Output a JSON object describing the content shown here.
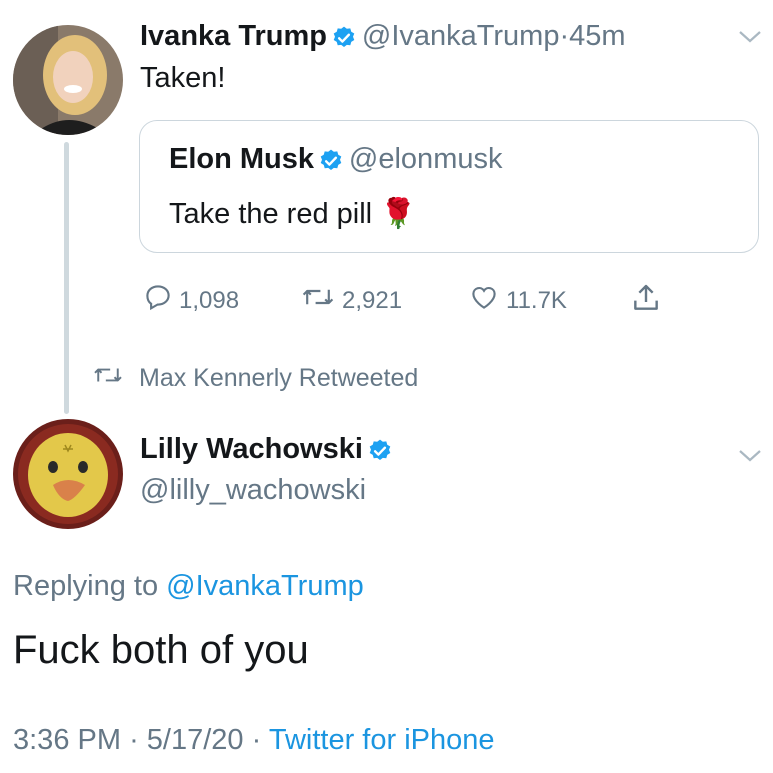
{
  "tweet1": {
    "name": "Ivanka Trump",
    "handle": "@IvankaTrump",
    "separator": "·",
    "time": "45m",
    "text": "Taken!",
    "quote": {
      "name": "Elon Musk",
      "handle": "@elonmusk",
      "text": "Take the red pill",
      "emoji": "🌹"
    },
    "actions": {
      "replies": "1,098",
      "retweets": "2,921",
      "likes": "11.7K"
    }
  },
  "retweet_banner": "Max Kennerly Retweeted",
  "tweet2": {
    "name": "Lilly Wachowski",
    "handle": "@lilly_wachowski",
    "replying_prefix": "Replying to",
    "replying_handle": "@IvankaTrump",
    "text": "Fuck both of you",
    "time": "3:36 PM",
    "date": "5/17/20",
    "sep1": "·",
    "sep2": "·",
    "source": "Twitter for iPhone"
  },
  "colors": {
    "verified": "#1da1f2",
    "link": "#1b95e0",
    "secondary_text": "#657786"
  },
  "icons": [
    "verified-badge-icon",
    "chevron-down-icon",
    "reply-icon",
    "retweet-icon",
    "like-icon",
    "share-icon"
  ]
}
